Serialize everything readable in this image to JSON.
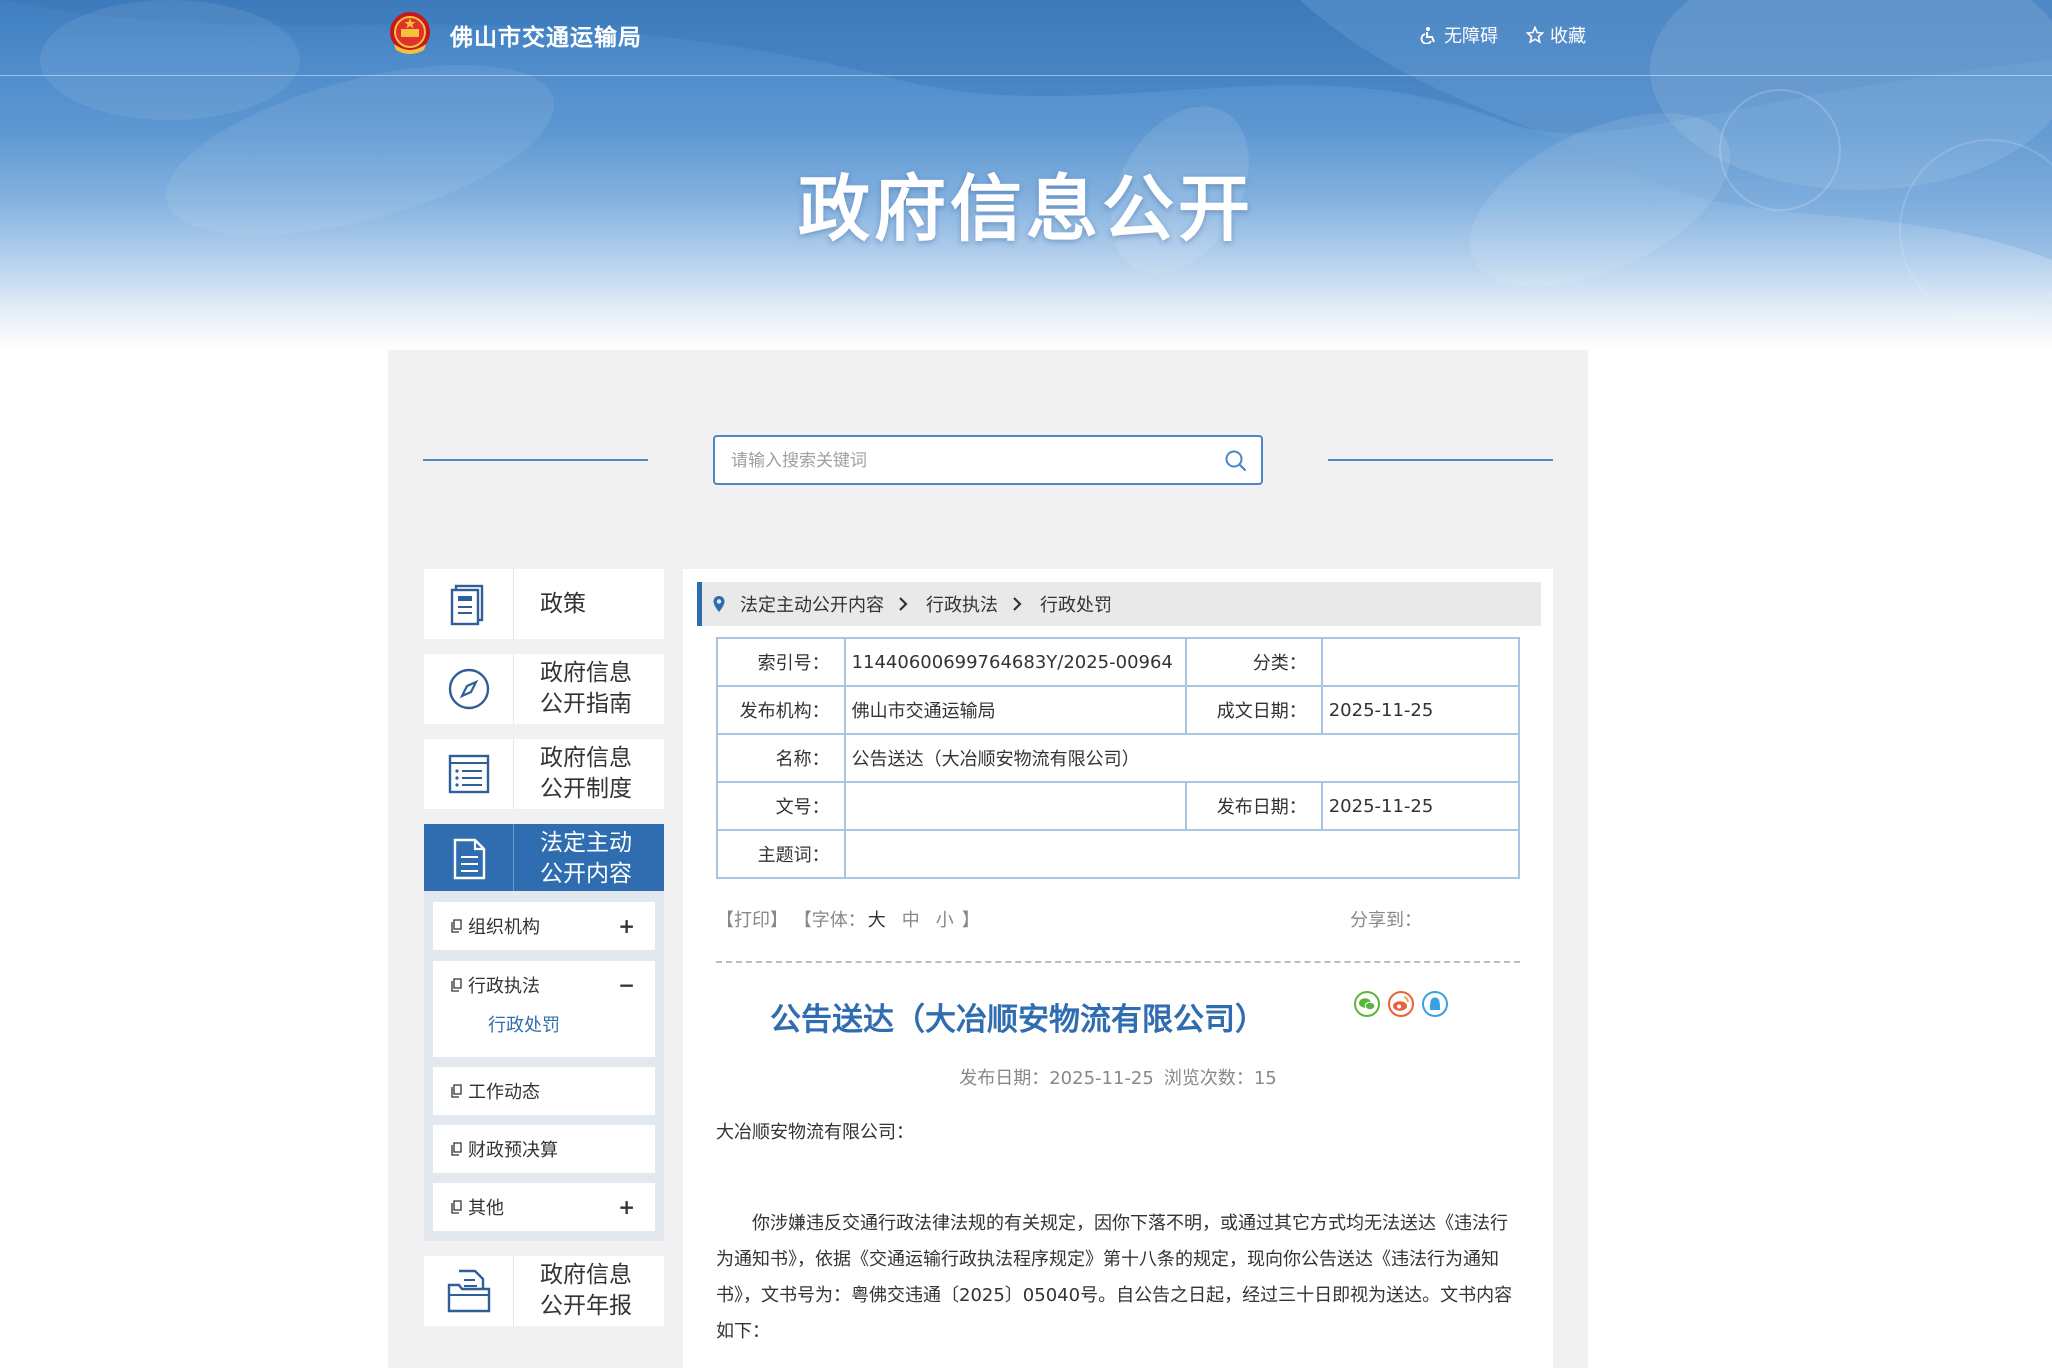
{
  "header": {
    "site_name": "佛山市交通运输局",
    "links": {
      "accessibility": "无障碍",
      "favorite": "收藏"
    },
    "banner_title": "政府信息公开"
  },
  "search": {
    "placeholder": "请输入搜索关键词"
  },
  "sidebar": {
    "nav": [
      {
        "label": "政策",
        "icon": "book-icon"
      },
      {
        "label_line1": "政府信息",
        "label_line2": "公开指南",
        "icon": "compass-icon"
      },
      {
        "label_line1": "政府信息",
        "label_line2": "公开制度",
        "icon": "list-icon"
      },
      {
        "label_line1": "法定主动",
        "label_line2": "公开内容",
        "icon": "document-icon",
        "active": true
      },
      {
        "label_line1": "政府信息",
        "label_line2": "公开年报",
        "icon": "folder-icon"
      }
    ],
    "sub": [
      {
        "label": "组织机构",
        "toggle": "+"
      },
      {
        "label": "行政执法",
        "toggle": "−",
        "child": "行政处罚"
      },
      {
        "label": "工作动态"
      },
      {
        "label": "财政预决算"
      },
      {
        "label": "其他",
        "toggle": "+"
      }
    ]
  },
  "breadcrumb": [
    "法定主动公开内容",
    "行政执法",
    "行政处罚"
  ],
  "meta": {
    "index_no": {
      "label": "索引号：",
      "value": "11440600699764683Y/2025-00964"
    },
    "category": {
      "label": "分类：",
      "value": ""
    },
    "publisher": {
      "label": "发布机构：",
      "value": "佛山市交通运输局"
    },
    "created_date": {
      "label": "成文日期：",
      "value": "2025-11-25"
    },
    "name": {
      "label": "名称：",
      "value": "公告送达（大冶顺安物流有限公司）"
    },
    "doc_no": {
      "label": "文号：",
      "value": ""
    },
    "publish_date": {
      "label": "发布日期：",
      "value": "2025-11-25"
    },
    "keywords": {
      "label": "主题词：",
      "value": ""
    }
  },
  "tools": {
    "print": "【打印】",
    "font_prefix": "【字体：",
    "font_large": "大",
    "font_medium": "中",
    "font_small": "小",
    "font_suffix": "】",
    "share_label": "分享到："
  },
  "article": {
    "title": "公告送达（大冶顺安物流有限公司）",
    "publish_date": "发布日期：2025-11-25",
    "views": "浏览次数：15",
    "addressee": "大冶顺安物流有限公司：",
    "body": "你涉嫌违反交通行政法律法规的有关规定，因你下落不明，或通过其它方式均无法送达《违法行为通知书》，依据《交通运输行政执法程序规定》第十八条的规定，现向你公告送达《违法行为通知书》，文书号为：粤佛交违通〔2025〕05040号。自公告之日起，经过三十日即视为送达。文书内容如下："
  },
  "colors": {
    "primary": "#2f6db0",
    "border": "#a9c5e4",
    "panel": "#f1f1f1"
  }
}
